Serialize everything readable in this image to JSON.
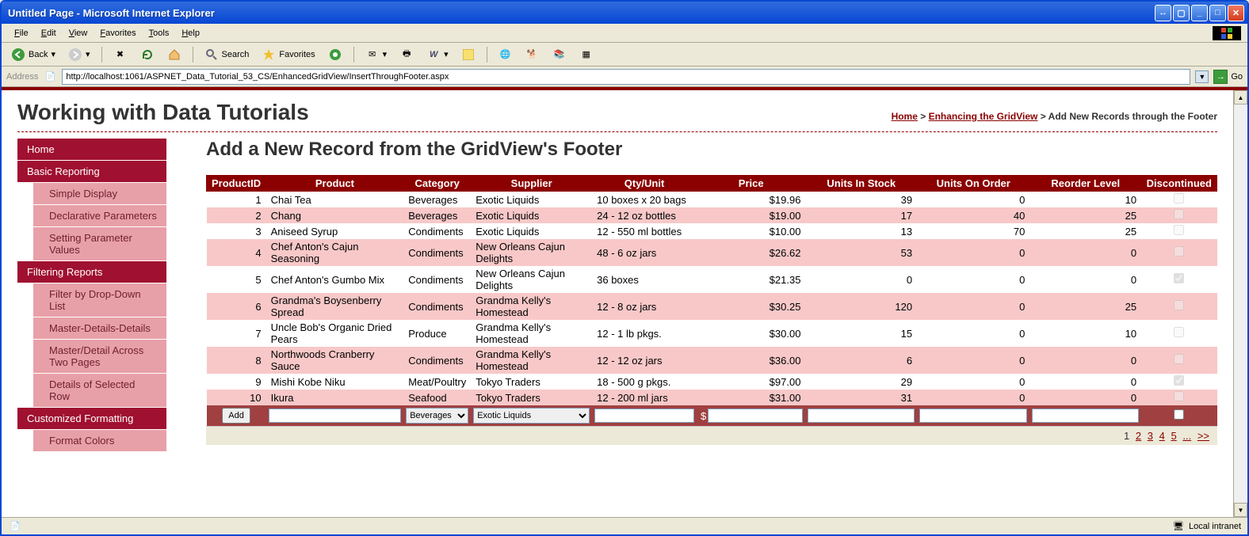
{
  "window": {
    "title": "Untitled Page - Microsoft Internet Explorer"
  },
  "menubar": [
    "File",
    "Edit",
    "View",
    "Favorites",
    "Tools",
    "Help"
  ],
  "toolbar": {
    "back": "Back",
    "search": "Search",
    "favorites": "Favorites"
  },
  "address": {
    "label": "Address",
    "url": "http://localhost:1061/ASPNET_Data_Tutorial_53_CS/EnhancedGridView/InsertThroughFooter.aspx",
    "go": "Go"
  },
  "page": {
    "site_title": "Working with Data Tutorials",
    "breadcrumb": {
      "home": "Home",
      "section": "Enhancing the GridView",
      "current": "Add New Records through the Footer"
    },
    "heading": "Add a New Record from the GridView's Footer"
  },
  "sidebar": [
    {
      "type": "head",
      "label": "Home"
    },
    {
      "type": "head",
      "label": "Basic Reporting"
    },
    {
      "type": "sub",
      "label": "Simple Display"
    },
    {
      "type": "sub",
      "label": "Declarative Parameters"
    },
    {
      "type": "sub",
      "label": "Setting Parameter Values"
    },
    {
      "type": "head",
      "label": "Filtering Reports"
    },
    {
      "type": "sub",
      "label": "Filter by Drop-Down List"
    },
    {
      "type": "sub",
      "label": "Master-Details-Details"
    },
    {
      "type": "sub",
      "label": "Master/Detail Across Two Pages"
    },
    {
      "type": "sub",
      "label": "Details of Selected Row"
    },
    {
      "type": "head",
      "label": "Customized Formatting"
    },
    {
      "type": "sub",
      "label": "Format Colors"
    }
  ],
  "grid": {
    "columns": [
      "ProductID",
      "Product",
      "Category",
      "Supplier",
      "Qty/Unit",
      "Price",
      "Units In Stock",
      "Units On Order",
      "Reorder Level",
      "Discontinued"
    ],
    "rows": [
      {
        "id": "1",
        "product": "Chai Tea",
        "category": "Beverages",
        "supplier": "Exotic Liquids",
        "qty": "10 boxes x 20 bags",
        "price": "$19.96",
        "stock": "39",
        "order": "0",
        "reorder": "10",
        "disc": false
      },
      {
        "id": "2",
        "product": "Chang",
        "category": "Beverages",
        "supplier": "Exotic Liquids",
        "qty": "24 - 12 oz bottles",
        "price": "$19.00",
        "stock": "17",
        "order": "40",
        "reorder": "25",
        "disc": false
      },
      {
        "id": "3",
        "product": "Aniseed Syrup",
        "category": "Condiments",
        "supplier": "Exotic Liquids",
        "qty": "12 - 550 ml bottles",
        "price": "$10.00",
        "stock": "13",
        "order": "70",
        "reorder": "25",
        "disc": false
      },
      {
        "id": "4",
        "product": "Chef Anton's Cajun Seasoning",
        "category": "Condiments",
        "supplier": "New Orleans Cajun Delights",
        "qty": "48 - 6 oz jars",
        "price": "$26.62",
        "stock": "53",
        "order": "0",
        "reorder": "0",
        "disc": false
      },
      {
        "id": "5",
        "product": "Chef Anton's Gumbo Mix",
        "category": "Condiments",
        "supplier": "New Orleans Cajun Delights",
        "qty": "36 boxes",
        "price": "$21.35",
        "stock": "0",
        "order": "0",
        "reorder": "0",
        "disc": true
      },
      {
        "id": "6",
        "product": "Grandma's Boysenberry Spread",
        "category": "Condiments",
        "supplier": "Grandma Kelly's Homestead",
        "qty": "12 - 8 oz jars",
        "price": "$30.25",
        "stock": "120",
        "order": "0",
        "reorder": "25",
        "disc": false
      },
      {
        "id": "7",
        "product": "Uncle Bob's Organic Dried Pears",
        "category": "Produce",
        "supplier": "Grandma Kelly's Homestead",
        "qty": "12 - 1 lb pkgs.",
        "price": "$30.00",
        "stock": "15",
        "order": "0",
        "reorder": "10",
        "disc": false
      },
      {
        "id": "8",
        "product": "Northwoods Cranberry Sauce",
        "category": "Condiments",
        "supplier": "Grandma Kelly's Homestead",
        "qty": "12 - 12 oz jars",
        "price": "$36.00",
        "stock": "6",
        "order": "0",
        "reorder": "0",
        "disc": false
      },
      {
        "id": "9",
        "product": "Mishi Kobe Niku",
        "category": "Meat/Poultry",
        "supplier": "Tokyo Traders",
        "qty": "18 - 500 g pkgs.",
        "price": "$97.00",
        "stock": "29",
        "order": "0",
        "reorder": "0",
        "disc": true
      },
      {
        "id": "10",
        "product": "Ikura",
        "category": "Seafood",
        "supplier": "Tokyo Traders",
        "qty": "12 - 200 ml jars",
        "price": "$31.00",
        "stock": "31",
        "order": "0",
        "reorder": "0",
        "disc": false
      }
    ],
    "footer": {
      "add": "Add",
      "category_select": "Beverages",
      "supplier_select": "Exotic Liquids",
      "currency": "$"
    },
    "pager": {
      "current": "1",
      "links": [
        "2",
        "3",
        "4",
        "5"
      ],
      "more": "...",
      "next": ">>"
    }
  },
  "statusbar": {
    "zone": "Local intranet"
  }
}
